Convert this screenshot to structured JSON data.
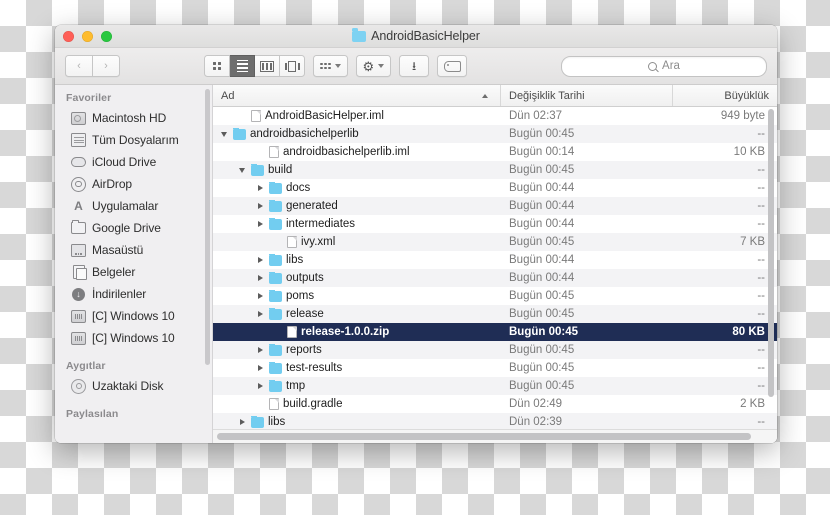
{
  "window": {
    "title": "AndroidBasicHelper",
    "traffic_lights": [
      "close",
      "minimize",
      "zoom"
    ]
  },
  "toolbar": {
    "back_label": "‹",
    "forward_label": "›",
    "view_modes": [
      {
        "name": "icon-view",
        "active": false
      },
      {
        "name": "list-view",
        "active": true
      },
      {
        "name": "column-view",
        "active": false
      },
      {
        "name": "coverflow-view",
        "active": false
      }
    ],
    "arrange_label": "arrange-by",
    "action_label": "action-gear",
    "share_label": "share",
    "tags_label": "tags",
    "search": {
      "placeholder": "Ara",
      "value": ""
    }
  },
  "sidebar": {
    "sections": [
      {
        "header": "Favoriler",
        "items": [
          {
            "label": "Macintosh HD",
            "icon": "harddisk-icon"
          },
          {
            "label": "Tüm Dosyalarım",
            "icon": "all-files-icon"
          },
          {
            "label": "iCloud Drive",
            "icon": "cloud-icon"
          },
          {
            "label": "AirDrop",
            "icon": "airdrop-icon"
          },
          {
            "label": "Uygulamalar",
            "icon": "applications-icon"
          },
          {
            "label": "Google Drive",
            "icon": "folder-icon"
          },
          {
            "label": "Masaüstü",
            "icon": "desktop-icon"
          },
          {
            "label": "Belgeler",
            "icon": "documents-icon"
          },
          {
            "label": "İndirilenler",
            "icon": "downloads-icon"
          },
          {
            "label": "[C] Windows 10",
            "icon": "windows-drive-icon"
          },
          {
            "label": "[C] Windows 10",
            "icon": "windows-drive-icon"
          }
        ]
      },
      {
        "header": "Aygıtlar",
        "items": [
          {
            "label": "Uzaktaki Disk",
            "icon": "disc-icon"
          }
        ]
      },
      {
        "header": "Paylasılan",
        "items": []
      }
    ]
  },
  "filelist": {
    "columns": {
      "name": "Ad",
      "date": "Değişiklik Tarihi",
      "size": "Büyüklük"
    },
    "sort_column": "name",
    "sort_direction": "ascending",
    "rows": [
      {
        "name": "AndroidBasicHelper.iml",
        "date": "Dün 02:37",
        "size": "949 byte",
        "type": "file",
        "indent": 1,
        "twisty": "none",
        "selected": false
      },
      {
        "name": "androidbasichelperlib",
        "date": "Bugün 00:45",
        "size": "--",
        "type": "folder",
        "indent": 0,
        "twisty": "open",
        "selected": false
      },
      {
        "name": "androidbasichelperlib.iml",
        "date": "Bugün 00:14",
        "size": "10 KB",
        "type": "file",
        "indent": 2,
        "twisty": "none",
        "selected": false
      },
      {
        "name": "build",
        "date": "Bugün 00:45",
        "size": "--",
        "type": "folder",
        "indent": 1,
        "twisty": "open",
        "selected": false
      },
      {
        "name": "docs",
        "date": "Bugün 00:44",
        "size": "--",
        "type": "folder",
        "indent": 2,
        "twisty": "closed",
        "selected": false
      },
      {
        "name": "generated",
        "date": "Bugün 00:44",
        "size": "--",
        "type": "folder",
        "indent": 2,
        "twisty": "closed",
        "selected": false
      },
      {
        "name": "intermediates",
        "date": "Bugün 00:44",
        "size": "--",
        "type": "folder",
        "indent": 2,
        "twisty": "closed",
        "selected": false
      },
      {
        "name": "ivy.xml",
        "date": "Bugün 00:45",
        "size": "7 KB",
        "type": "file",
        "indent": 3,
        "twisty": "none",
        "selected": false
      },
      {
        "name": "libs",
        "date": "Bugün 00:44",
        "size": "--",
        "type": "folder",
        "indent": 2,
        "twisty": "closed",
        "selected": false
      },
      {
        "name": "outputs",
        "date": "Bugün 00:44",
        "size": "--",
        "type": "folder",
        "indent": 2,
        "twisty": "closed",
        "selected": false
      },
      {
        "name": "poms",
        "date": "Bugün 00:45",
        "size": "--",
        "type": "folder",
        "indent": 2,
        "twisty": "closed",
        "selected": false
      },
      {
        "name": "release",
        "date": "Bugün 00:45",
        "size": "--",
        "type": "folder",
        "indent": 2,
        "twisty": "closed",
        "selected": false
      },
      {
        "name": "release-1.0.0.zip",
        "date": "Bugün 00:45",
        "size": "80 KB",
        "type": "file",
        "indent": 3,
        "twisty": "none",
        "selected": true
      },
      {
        "name": "reports",
        "date": "Bugün 00:45",
        "size": "--",
        "type": "folder",
        "indent": 2,
        "twisty": "closed",
        "selected": false
      },
      {
        "name": "test-results",
        "date": "Bugün 00:45",
        "size": "--",
        "type": "folder",
        "indent": 2,
        "twisty": "closed",
        "selected": false
      },
      {
        "name": "tmp",
        "date": "Bugün 00:45",
        "size": "--",
        "type": "folder",
        "indent": 2,
        "twisty": "closed",
        "selected": false
      },
      {
        "name": "build.gradle",
        "date": "Dün 02:49",
        "size": "2 KB",
        "type": "file",
        "indent": 2,
        "twisty": "none",
        "selected": false
      },
      {
        "name": "libs",
        "date": "Dün 02:39",
        "size": "--",
        "type": "folder",
        "indent": 1,
        "twisty": "closed",
        "selected": false
      }
    ]
  },
  "colors": {
    "selection": "#1f2d55",
    "folder_icon": "#72cdf0",
    "sidebar_bg": "#f0eff1",
    "stripe": "#f3f3f5"
  }
}
